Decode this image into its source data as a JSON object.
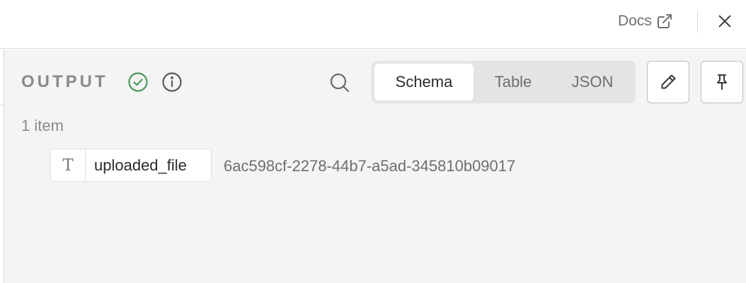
{
  "header": {
    "docs_label": "Docs",
    "docs_icon": "external-link-icon",
    "close_icon": "close-icon"
  },
  "output": {
    "title": "OUTPUT",
    "status_icon": "check-circle-icon",
    "info_icon": "info-icon",
    "search_icon": "search-icon",
    "views": [
      {
        "label": "Schema",
        "active": true
      },
      {
        "label": "Table",
        "active": false
      },
      {
        "label": "JSON",
        "active": false
      }
    ],
    "edit_icon": "pencil-icon",
    "pin_icon": "pin-icon",
    "item_count": "1 item",
    "fields": [
      {
        "type_glyph": "T",
        "type_icon": "text-type-icon",
        "name": "uploaded_file",
        "value": "6ac598cf-2278-44b7-a5ad-345810b09017"
      }
    ]
  },
  "colors": {
    "success": "#4a9a5b",
    "muted_text": "#8a8a8a",
    "panel_bg": "#f4f4f4",
    "toggle_bg": "#e4e4e4"
  }
}
